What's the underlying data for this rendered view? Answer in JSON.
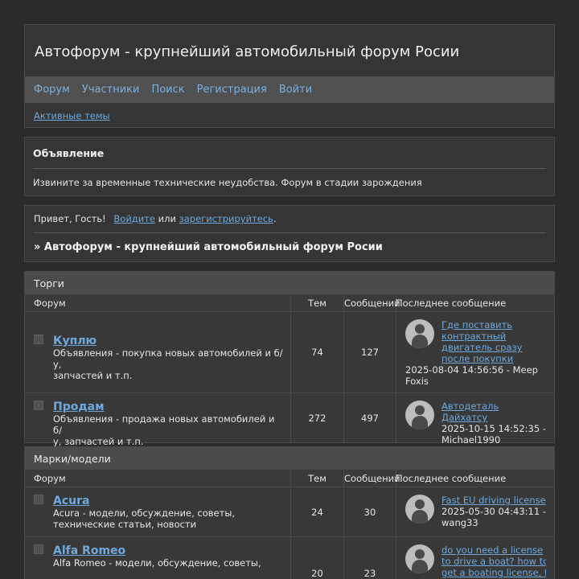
{
  "header": {
    "title": "Автофорум - крупнейший автомобильный форум Росии",
    "nav": [
      "Форум",
      "Участники",
      "Поиск",
      "Регистрация",
      "Войти"
    ],
    "active_topics": "Активные темы"
  },
  "announcement": {
    "title": "Объявление",
    "text": "Извините за временные технические неудобства. Форум в стадии зарождения"
  },
  "welcome": {
    "greeting": "Привет, Гость!",
    "login": "Войдите",
    "or": "или",
    "register": "зарегистрируйтесь",
    "period": ".",
    "breadcrumb": "» Автофорум - крупнейший автомобильный форум Росии"
  },
  "columns": {
    "forum": "Форум",
    "topics": "Тем",
    "posts": "Сообщений",
    "last": "Последнее сообщение"
  },
  "categories": [
    {
      "name": "Торги",
      "forums": [
        {
          "name": "Куплю",
          "desc_line1": "Объявления - покупка новых автомобилей и б/у,",
          "desc_line2": "запчастей и т.п.",
          "topics": "74",
          "posts": "127",
          "last_title_lines": [
            "Где поставить",
            "контрактный",
            "двигатель сразу",
            "после покупки"
          ],
          "last_meta_lines": [
            "2025-08-04 14:56:56 - Meep",
            "Foxis"
          ]
        },
        {
          "name": "Продам",
          "desc_line1": "Объявления - продажа новых автомобилей и б/",
          "desc_line2": "у, запчастей и т.п.",
          "topics": "272",
          "posts": "497",
          "last_title_lines": [
            "Автодеталь Дайхатсу"
          ],
          "last_meta_lines": [
            "2025-10-15 14:52:35 -",
            "Michael1990"
          ]
        }
      ]
    },
    {
      "name": "Марки/модели",
      "forums": [
        {
          "name": "Acura",
          "desc_line1": "Acura - модели, обсуждение, советы,",
          "desc_line2": "технические статьи, новости",
          "topics": "24",
          "posts": "30",
          "last_title_lines": [
            "Fast EU driving license"
          ],
          "last_meta_lines": [
            "2025-05-30 04:43:11 -",
            "wang33"
          ]
        },
        {
          "name": "Alfa Romeo",
          "desc_line1": "Alfa Romeo - модели, обсуждение, советы,",
          "desc_line2": "",
          "topics": "20",
          "posts": "23",
          "last_title_lines": [
            "do you need a license",
            "to drive a boat? how to",
            "get a boating license, f"
          ],
          "last_meta_lines": []
        }
      ]
    }
  ]
}
